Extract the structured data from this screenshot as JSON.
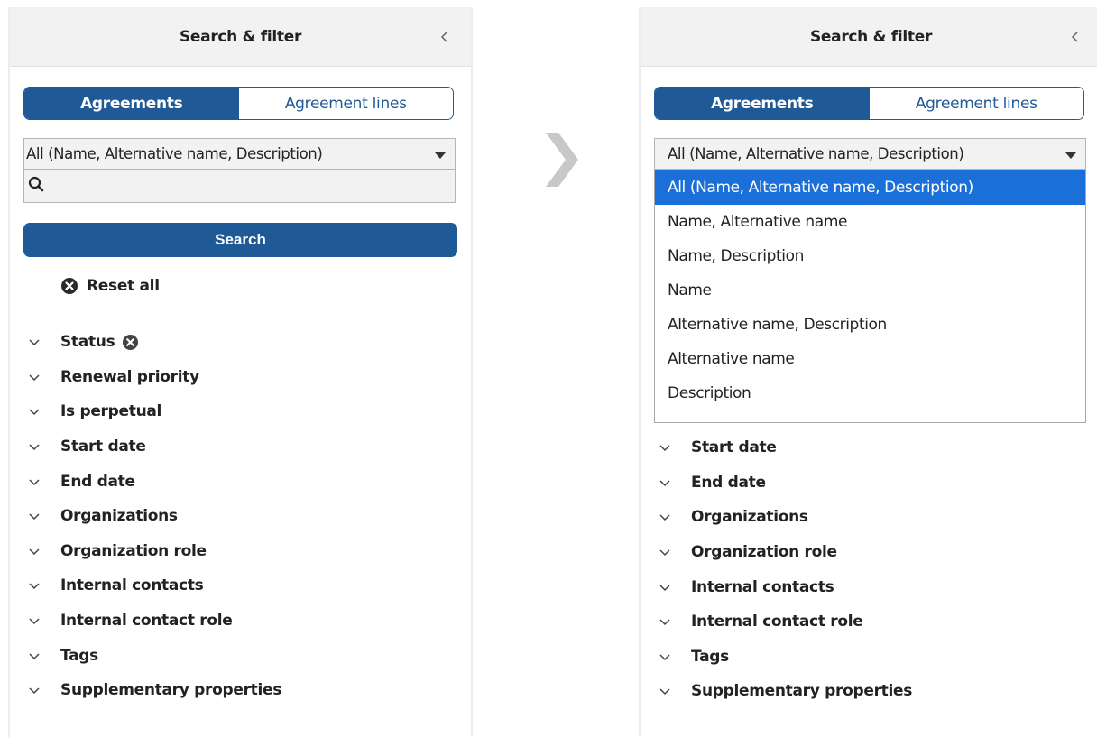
{
  "left_panel": {
    "title": "Search & filter",
    "tabs": [
      "Agreements",
      "Agreement lines"
    ],
    "search_scope": "All (Name, Alternative name, Description)",
    "search_input_value": "",
    "search_button": "Search",
    "reset_all": "Reset all",
    "filters": [
      "Status",
      "Renewal priority",
      "Is perpetual",
      "Start date",
      "End date",
      "Organizations",
      "Organization role",
      "Internal contacts",
      "Internal contact role",
      "Tags",
      "Supplementary properties"
    ]
  },
  "right_panel": {
    "title": "Search & filter",
    "tabs": [
      "Agreements",
      "Agreement lines"
    ],
    "search_scope": "All (Name, Alternative name, Description)",
    "dropdown_options": [
      "All (Name, Alternative name, Description)",
      "Name, Alternative name",
      "Name, Description",
      "Name",
      "Alternative name, Description",
      "Alternative name",
      "Description"
    ],
    "filters": [
      "Start date",
      "End date",
      "Organizations",
      "Organization role",
      "Internal contacts",
      "Internal contact role",
      "Tags",
      "Supplementary properties"
    ]
  },
  "colors": {
    "primary": "#1f5a96",
    "option_highlight": "#1a6fd8",
    "header_bg": "#f2f2f2"
  },
  "icons": [
    "chevron-left-icon",
    "search-icon",
    "clear-circle-icon",
    "chevron-down-icon",
    "next-step-arrow-icon"
  ]
}
